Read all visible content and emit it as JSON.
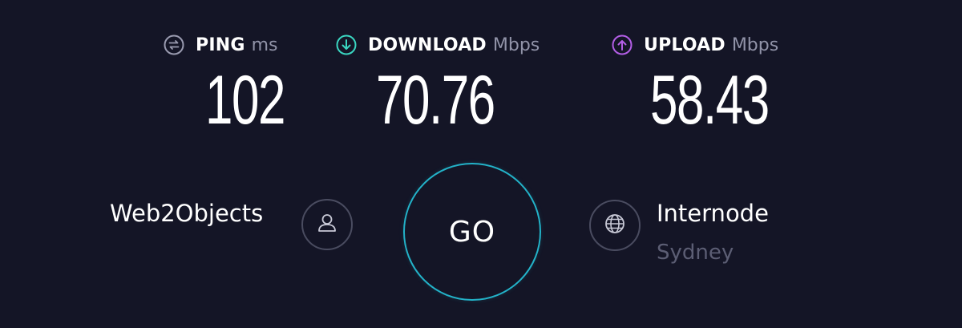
{
  "metrics": {
    "ping": {
      "label": "PING",
      "unit": "ms",
      "value": "102",
      "icon": "ping-icon",
      "icon_color": "#9a9bb0"
    },
    "download": {
      "label": "DOWNLOAD",
      "unit": "Mbps",
      "value": "70.76",
      "icon": "download-arrow-icon",
      "icon_color": "#3ad6c1"
    },
    "upload": {
      "label": "UPLOAD",
      "unit": "Mbps",
      "value": "58.43",
      "icon": "upload-arrow-icon",
      "icon_color": "#b35ee6"
    }
  },
  "client": {
    "name": "Web2Objects",
    "icon": "user-icon"
  },
  "go_button": {
    "label": "GO",
    "ring_color": "#23b2c8"
  },
  "server": {
    "name": "Internode",
    "location": "Sydney",
    "icon": "globe-icon"
  },
  "theme": {
    "background": "#141526",
    "muted_text": "#9193a8",
    "dim_text": "#5c5e74"
  }
}
